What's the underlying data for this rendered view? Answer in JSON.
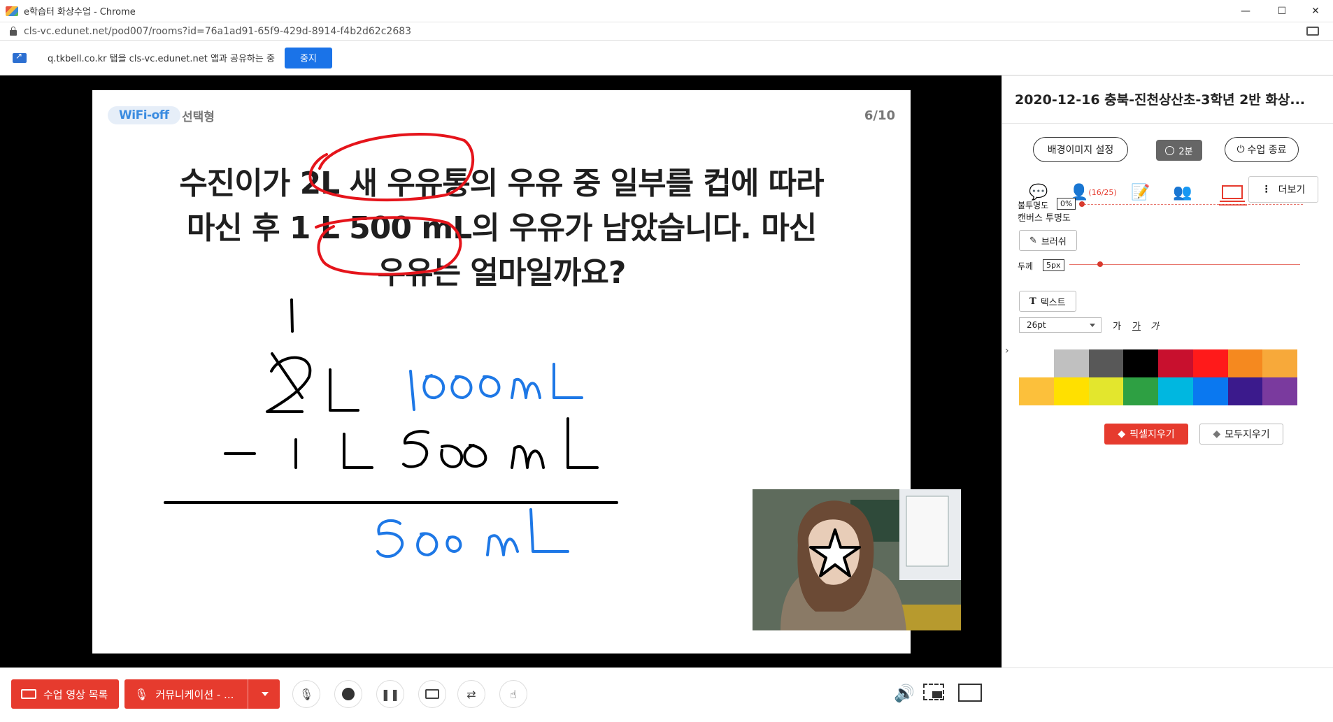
{
  "window": {
    "title": "e학습터 화상수업 - Chrome",
    "minimize": "—",
    "maximize": "☐",
    "close": "✕"
  },
  "address": {
    "url": "cls-vc.edunet.net/pod007/rooms?id=76a1ad91-65f9-429d-8914-f4b2d62c2683"
  },
  "share_bar": {
    "text": "q.tkbell.co.kr 탭을 cls-vc.edunet.net 앱과 공유하는 중",
    "stop_label": "중지"
  },
  "slide": {
    "tag": "WiFi-off",
    "type": "선택형",
    "page": "6/10",
    "question_lines": [
      "수진이가 2L 새 우유통의 우유 중 일부를 컵에 따라",
      "마신 후 1 L 500 mL의 우유가 남았습니다. 마신",
      "우유는 얼마일까요?"
    ]
  },
  "bottom_bar": {
    "video_list_label": "수업 영상 목록",
    "communication_label": "커뮤니케이션 - ..."
  },
  "panel": {
    "title": "2020-12-16 충북-진천상산초-3학년 2반 화상...",
    "bg_image_button": "배경이미지 설정",
    "timer": "2분",
    "end_class_button": "수업 종료",
    "participants": "(16/25)",
    "more_button": "더보기",
    "canvas_opacity_heading": "캔버스 투명도",
    "opacity_label": "불투명도",
    "opacity_value": "0%",
    "brush_button": "브러쉬",
    "thickness_label": "두께",
    "thickness_value": "5px",
    "text_button": "텍스트",
    "font_size": "26pt",
    "font_styles": [
      "가",
      "가",
      "가"
    ],
    "pixel_erase_button": "픽셀지우기",
    "erase_all_button": "모두지우기",
    "palette": [
      "#ffffff",
      "#c0c0c0",
      "#585858",
      "#000000",
      "#c8102e",
      "#ff1a1a",
      "#f5891f",
      "#f7a93a",
      "#fcc03b",
      "#ffe000",
      "#e3e62d",
      "#2ea043",
      "#00b7e0",
      "#0a78f0",
      "#3b1a8c",
      "#7a3a9e"
    ]
  }
}
